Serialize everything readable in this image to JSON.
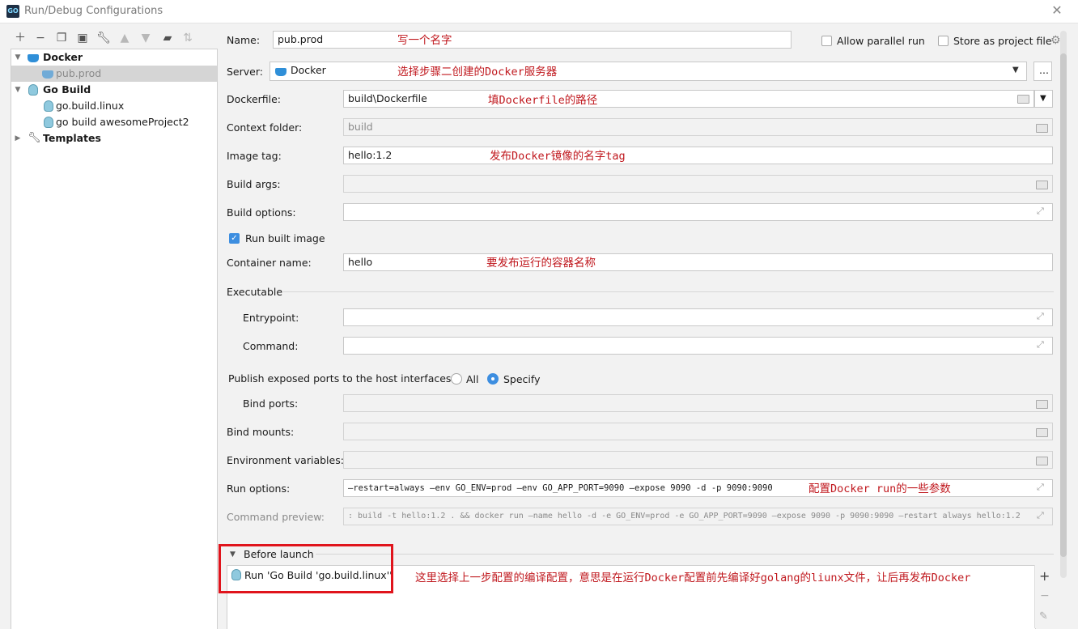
{
  "window": {
    "title": "Run/Debug Configurations",
    "app_icon": "GO"
  },
  "toolbar": {
    "icons": [
      "add-icon",
      "remove-icon",
      "copy-icon",
      "save-icon",
      "wrench-icon",
      "move-up-icon",
      "move-down-icon",
      "new-folder-icon",
      "sort-icon"
    ]
  },
  "tree": {
    "items": [
      {
        "label": "Docker",
        "bold": true,
        "expanded": true
      },
      {
        "label": "pub.prod",
        "selected": true
      },
      {
        "label": "Go Build",
        "bold": true,
        "expanded": true
      },
      {
        "label": "go.build.linux"
      },
      {
        "label": "go build awesomeProject2"
      },
      {
        "label": "Templates",
        "bold": true,
        "expanded": false
      }
    ]
  },
  "form": {
    "name_label": "Name:",
    "name_value": "pub.prod",
    "allow_parallel_label": "Allow parallel run",
    "allow_parallel_checked": false,
    "store_project_label": "Store as project file",
    "store_project_checked": false,
    "server_label": "Server:",
    "server_value": "Docker",
    "server_more": "...",
    "dockerfile_label": "Dockerfile:",
    "dockerfile_value": "build\\Dockerfile",
    "context_label": "Context folder:",
    "context_placeholder": "build",
    "image_tag_label": "Image tag:",
    "image_tag_value": "hello:1.2",
    "build_args_label": "Build args:",
    "build_options_label": "Build options:",
    "run_built_label": "Run built image",
    "run_built_checked": true,
    "container_name_label": "Container name:",
    "container_name_value": "hello",
    "executable_label": "Executable",
    "entrypoint_label": "Entrypoint:",
    "command_label": "Command:",
    "publish_label": "Publish exposed ports to the host interfaces:",
    "publish_all": "All",
    "publish_specify": "Specify",
    "publish_selected": "Specify",
    "bind_ports_label": "Bind ports:",
    "bind_mounts_label": "Bind mounts:",
    "env_label": "Environment variables:",
    "run_options_label": "Run options:",
    "run_options_value": "—restart=always —env GO_ENV=prod —env GO_APP_PORT=9090 —expose 9090 -d -p 9090:9090",
    "command_preview_label": "Command preview:",
    "command_preview_value": ": build -t hello:1.2 . && docker run —name hello -d -e GO_ENV=prod -e GO_APP_PORT=9090 —expose 9090 -p 9090:9090 —restart always hello:1.2",
    "before_launch_label": "Before launch",
    "before_launch_item": "Run 'Go Build 'go.build.linux''"
  },
  "annotations": {
    "name": "写一个名字",
    "server": "选择步骤二创建的Docker服务器",
    "dockerfile": "填Dockerfile的路径",
    "image_tag": "发布Docker镜像的名字tag",
    "container": "要发布运行的容器名称",
    "run_options": "配置Docker run的一些参数",
    "before_launch": "这里选择上一步配置的编译配置，意思是在运行Docker配置前先编译好golang的liunx文件，让后再发布Docker"
  },
  "colors": {
    "annotation": "#c0181e",
    "highlight_box": "#e0141c",
    "accent": "#3d8ee0"
  }
}
